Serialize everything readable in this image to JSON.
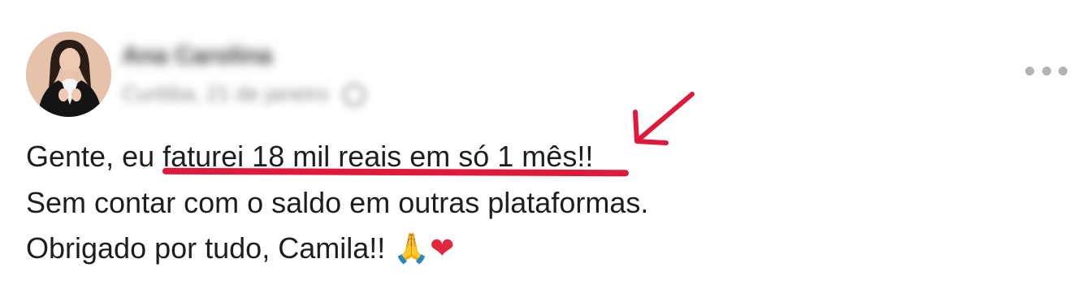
{
  "post": {
    "author_name": "Ana Carolina",
    "meta": "Curitiba, 21 de janeiro",
    "lines": {
      "line1_prefix": "Gente, eu ",
      "line1_highlight": "faturei 18 mil reais em só 1 mês!!",
      "line2": "Sem contar com o saldo em outras plataformas.",
      "line3_text": "Obrigado por tudo, Camila!! ",
      "line3_emoji_pray": "🙏",
      "line3_emoji_heart": "❤"
    }
  },
  "icons": {
    "more": "more-horizontal-icon",
    "privacy": "globe-icon",
    "annotation": "red-arrow-icon"
  },
  "colors": {
    "annotation_red": "#e0193a",
    "text": "#1c1e21",
    "muted": "#8a8d91"
  }
}
